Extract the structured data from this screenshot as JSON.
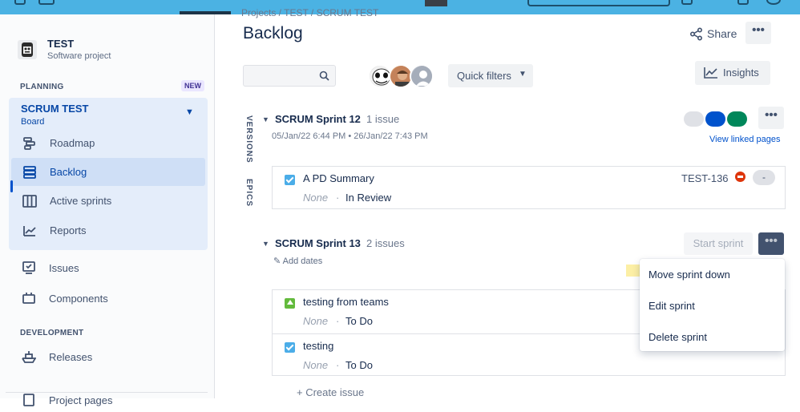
{
  "project": {
    "name": "TEST",
    "type": "Software project"
  },
  "sidebar": {
    "planning_header": "PLANNING",
    "new_badge": "NEW",
    "board": {
      "title": "SCRUM TEST",
      "subtitle": "Board"
    },
    "board_items": [
      {
        "label": "Roadmap",
        "icon": "roadmap-icon"
      },
      {
        "label": "Backlog",
        "icon": "backlog-icon",
        "active": true
      },
      {
        "label": "Active sprints",
        "icon": "board-columns-icon"
      },
      {
        "label": "Reports",
        "icon": "chart-icon"
      }
    ],
    "items": [
      {
        "label": "Issues",
        "icon": "issues-icon"
      },
      {
        "label": "Components",
        "icon": "components-icon"
      }
    ],
    "development_header": "DEVELOPMENT",
    "dev_items": [
      {
        "label": "Releases",
        "icon": "ship-icon"
      },
      {
        "label": "Project pages",
        "icon": "page-icon"
      }
    ]
  },
  "breadcrumb": "Projects  /  TEST  /  SCRUM TEST",
  "page": {
    "title": "Backlog",
    "share_label": "Share",
    "more_label": "•••"
  },
  "toolbar": {
    "search_placeholder": "",
    "quick_filters_label": "Quick filters",
    "insights_label": "Insights"
  },
  "side_tabs": {
    "versions": "VERSIONS",
    "epics": "EPICS"
  },
  "sprints": [
    {
      "name": "SCRUM Sprint 12",
      "count": "1 issue",
      "dates": "05/Jan/22 6:44 PM  •  26/Jan/22 7:43 PM",
      "status_colors": [
        "#dfe1e6",
        "#0052cc",
        "#00875a"
      ],
      "linked_label": "View linked pages",
      "issues": [
        {
          "title": "A PD Summary",
          "epic": "None",
          "status": "In Review",
          "key": "TEST-136",
          "estimate": "-",
          "type": "task"
        }
      ]
    },
    {
      "name": "SCRUM Sprint 13",
      "count": "2 issues",
      "add_dates_label": "Add dates",
      "start_label": "Start sprint",
      "issues": [
        {
          "title": "testing from teams",
          "epic": "None",
          "status": "To Do",
          "type": "story"
        },
        {
          "title": "testing",
          "epic": "None",
          "status": "To Do",
          "type": "task"
        }
      ]
    }
  ],
  "create_issue_label": "+  Create issue",
  "sprint_menu": {
    "items": [
      "Move sprint down",
      "Edit sprint",
      "Delete sprint"
    ],
    "highlight_color": "#fcefa5"
  }
}
